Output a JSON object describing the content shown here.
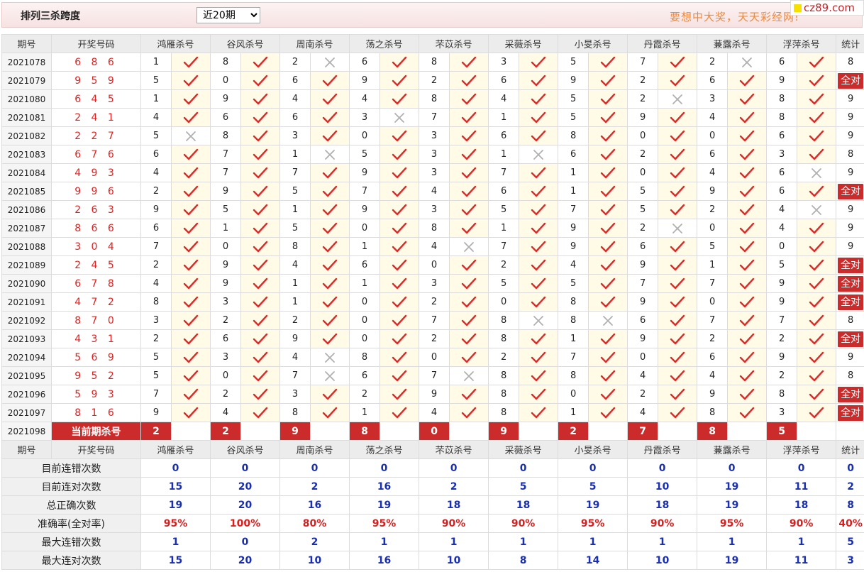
{
  "header": {
    "title": "排列三杀跨度",
    "select_value": "近20期",
    "slogan": "要想中大奖，天天彩经网!",
    "brand": "cz89.com"
  },
  "columns": {
    "issue": "期号",
    "draw": "开奖号码",
    "experts": [
      "鸿雁杀号",
      "谷风杀号",
      "周南杀号",
      "荡之杀号",
      "芣苡杀号",
      "采薇杀号",
      "小旻杀号",
      "丹霞杀号",
      "蒹露杀号",
      "浮萍杀号"
    ],
    "stat": "统计"
  },
  "rows": [
    {
      "issue": "2021078",
      "draw": "6 8 6",
      "kills": [
        1,
        8,
        2,
        6,
        8,
        3,
        5,
        7,
        2,
        6
      ],
      "hits": [
        1,
        1,
        0,
        1,
        1,
        1,
        1,
        1,
        0,
        1
      ],
      "stat": "8"
    },
    {
      "issue": "2021079",
      "draw": "9 5 9",
      "kills": [
        5,
        0,
        6,
        9,
        2,
        6,
        9,
        2,
        6,
        9
      ],
      "hits": [
        1,
        1,
        1,
        1,
        1,
        1,
        1,
        1,
        1,
        1
      ],
      "stat": "全对"
    },
    {
      "issue": "2021080",
      "draw": "6 4 5",
      "kills": [
        1,
        9,
        4,
        4,
        8,
        4,
        5,
        2,
        3,
        8
      ],
      "hits": [
        1,
        1,
        1,
        1,
        1,
        1,
        1,
        0,
        1,
        1
      ],
      "stat": "9"
    },
    {
      "issue": "2021081",
      "draw": "2 4 1",
      "kills": [
        4,
        6,
        6,
        3,
        7,
        1,
        5,
        9,
        4,
        8
      ],
      "hits": [
        1,
        1,
        1,
        0,
        1,
        1,
        1,
        1,
        1,
        1
      ],
      "stat": "9"
    },
    {
      "issue": "2021082",
      "draw": "2 2 7",
      "kills": [
        5,
        8,
        3,
        0,
        3,
        6,
        8,
        0,
        0,
        6
      ],
      "hits": [
        0,
        1,
        1,
        1,
        1,
        1,
        1,
        1,
        1,
        1
      ],
      "stat": "9"
    },
    {
      "issue": "2021083",
      "draw": "6 7 6",
      "kills": [
        6,
        7,
        1,
        5,
        3,
        1,
        6,
        2,
        6,
        3
      ],
      "hits": [
        1,
        1,
        0,
        1,
        1,
        0,
        1,
        1,
        1,
        1
      ],
      "stat": "8"
    },
    {
      "issue": "2021084",
      "draw": "4 9 3",
      "kills": [
        4,
        7,
        7,
        9,
        3,
        7,
        1,
        0,
        4,
        6
      ],
      "hits": [
        1,
        1,
        1,
        1,
        1,
        1,
        1,
        1,
        1,
        0
      ],
      "stat": "9"
    },
    {
      "issue": "2021085",
      "draw": "9 9 6",
      "kills": [
        2,
        9,
        5,
        7,
        4,
        6,
        1,
        5,
        9,
        6
      ],
      "hits": [
        1,
        1,
        1,
        1,
        1,
        1,
        1,
        1,
        1,
        1
      ],
      "stat": "全对"
    },
    {
      "issue": "2021086",
      "draw": "2 6 3",
      "kills": [
        9,
        5,
        1,
        9,
        3,
        5,
        7,
        5,
        2,
        4
      ],
      "hits": [
        1,
        1,
        1,
        1,
        1,
        1,
        1,
        1,
        1,
        0
      ],
      "stat": "9"
    },
    {
      "issue": "2021087",
      "draw": "8 6 6",
      "kills": [
        6,
        1,
        5,
        0,
        8,
        1,
        9,
        2,
        0,
        4
      ],
      "hits": [
        1,
        1,
        1,
        1,
        1,
        1,
        1,
        0,
        1,
        1
      ],
      "stat": "9"
    },
    {
      "issue": "2021088",
      "draw": "3 0 4",
      "kills": [
        7,
        0,
        8,
        1,
        4,
        7,
        9,
        6,
        5,
        0
      ],
      "hits": [
        1,
        1,
        1,
        1,
        0,
        1,
        1,
        1,
        1,
        1
      ],
      "stat": "9"
    },
    {
      "issue": "2021089",
      "draw": "2 4 5",
      "kills": [
        2,
        9,
        4,
        6,
        0,
        2,
        4,
        9,
        1,
        5
      ],
      "hits": [
        1,
        1,
        1,
        1,
        1,
        1,
        1,
        1,
        1,
        1
      ],
      "stat": "全对"
    },
    {
      "issue": "2021090",
      "draw": "6 7 8",
      "kills": [
        4,
        9,
        1,
        1,
        3,
        5,
        5,
        7,
        7,
        9
      ],
      "hits": [
        1,
        1,
        1,
        1,
        1,
        1,
        1,
        1,
        1,
        1
      ],
      "stat": "全对"
    },
    {
      "issue": "2021091",
      "draw": "4 7 2",
      "kills": [
        8,
        3,
        1,
        0,
        2,
        0,
        8,
        9,
        0,
        9
      ],
      "hits": [
        1,
        1,
        1,
        1,
        1,
        1,
        1,
        1,
        1,
        1
      ],
      "stat": "全对"
    },
    {
      "issue": "2021092",
      "draw": "8 7 0",
      "kills": [
        3,
        2,
        2,
        0,
        7,
        8,
        8,
        6,
        7,
        7
      ],
      "hits": [
        1,
        1,
        1,
        1,
        1,
        0,
        0,
        1,
        1,
        1
      ],
      "stat": "8"
    },
    {
      "issue": "2021093",
      "draw": "4 3 1",
      "kills": [
        2,
        6,
        9,
        0,
        2,
        8,
        1,
        9,
        2,
        2
      ],
      "hits": [
        1,
        1,
        1,
        1,
        1,
        1,
        1,
        1,
        1,
        1
      ],
      "stat": "全对"
    },
    {
      "issue": "2021094",
      "draw": "5 6 9",
      "kills": [
        5,
        3,
        4,
        8,
        0,
        2,
        7,
        0,
        6,
        9
      ],
      "hits": [
        1,
        1,
        0,
        1,
        1,
        1,
        1,
        1,
        1,
        1
      ],
      "stat": "9"
    },
    {
      "issue": "2021095",
      "draw": "9 5 2",
      "kills": [
        5,
        0,
        7,
        6,
        7,
        8,
        8,
        4,
        4,
        2
      ],
      "hits": [
        1,
        1,
        0,
        1,
        0,
        1,
        1,
        1,
        1,
        1
      ],
      "stat": "8"
    },
    {
      "issue": "2021096",
      "draw": "5 9 3",
      "kills": [
        7,
        2,
        3,
        2,
        9,
        8,
        0,
        2,
        9,
        8
      ],
      "hits": [
        1,
        1,
        1,
        1,
        1,
        1,
        1,
        1,
        1,
        1
      ],
      "stat": "全对"
    },
    {
      "issue": "2021097",
      "draw": "8 1 6",
      "kills": [
        9,
        4,
        8,
        1,
        4,
        8,
        1,
        4,
        8,
        3
      ],
      "hits": [
        1,
        1,
        1,
        1,
        1,
        1,
        1,
        1,
        1,
        1
      ],
      "stat": "全对"
    }
  ],
  "current": {
    "issue": "2021098",
    "label": "当前期杀号",
    "kills": [
      "2",
      "2",
      "9",
      "8",
      "0",
      "9",
      "2",
      "7",
      "8",
      "5"
    ]
  },
  "summary": [
    {
      "label": "目前连错次数",
      "values": [
        "0",
        "0",
        "0",
        "0",
        "0",
        "0",
        "0",
        "0",
        "0",
        "0"
      ],
      "stat": "0",
      "red": false
    },
    {
      "label": "目前连对次数",
      "values": [
        "15",
        "20",
        "2",
        "16",
        "2",
        "5",
        "5",
        "10",
        "19",
        "11"
      ],
      "stat": "2",
      "red": false
    },
    {
      "label": "总正确次数",
      "values": [
        "19",
        "20",
        "16",
        "19",
        "18",
        "18",
        "19",
        "18",
        "19",
        "18"
      ],
      "stat": "8",
      "red": false
    },
    {
      "label": "准确率(全对率)",
      "values": [
        "95%",
        "100%",
        "80%",
        "95%",
        "90%",
        "90%",
        "95%",
        "90%",
        "95%",
        "90%"
      ],
      "stat": "40%",
      "red": true
    },
    {
      "label": "最大连错次数",
      "values": [
        "1",
        "0",
        "2",
        "1",
        "1",
        "1",
        "1",
        "1",
        "1",
        "1"
      ],
      "stat": "5",
      "red": false
    },
    {
      "label": "最大连对次数",
      "values": [
        "15",
        "20",
        "10",
        "16",
        "10",
        "8",
        "14",
        "10",
        "19",
        "11"
      ],
      "stat": "3",
      "red": false
    }
  ],
  "icons": {
    "hit": "check-icon",
    "miss": "cross-icon",
    "hit_color": "#e02828",
    "miss_color": "#b0b0b0"
  }
}
